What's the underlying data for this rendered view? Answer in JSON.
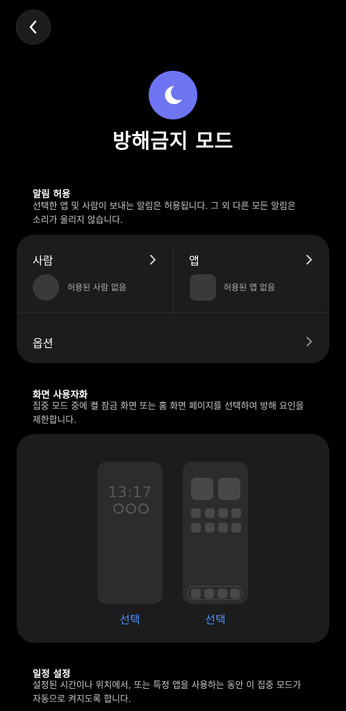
{
  "nav": {
    "back_icon": "chevron-left-icon"
  },
  "header": {
    "icon": "moon-icon",
    "icon_color": "#6e75f2",
    "title": "방해금지 모드"
  },
  "allow_section": {
    "title": "알림 허용",
    "description_line1": "선택한 앱 및 사람이 보내는 알림은 허용됩니다. 그 외 다른 모든 알림은",
    "description_line2": "소리가 울리지 않습니다.",
    "people": {
      "label": "사람",
      "empty_text": "허용된 사람 없음"
    },
    "apps": {
      "label": "앱",
      "empty_text": "허용된 앱 없음"
    },
    "options": {
      "label": "옵션"
    }
  },
  "customize_section": {
    "title": "화면 사용자화",
    "description_line1": "집중 모드 중에 켤 잠금 화면 또는 홈 화면 페이지를 선택하여 방해 요인을",
    "description_line2": "제한합니다.",
    "lock_screen": {
      "time": "13:17",
      "select_label": "선택"
    },
    "home_screen": {
      "select_label": "선택"
    },
    "link_color": "#4d8ff7"
  },
  "schedule_section": {
    "title": "일정 설정",
    "description_line1": "설정된 시간이나 위치에서, 또는 특정 앱을 사용하는 동안 이 집중 모드가",
    "description_line2": "자동으로 켜지도록 합니다."
  }
}
